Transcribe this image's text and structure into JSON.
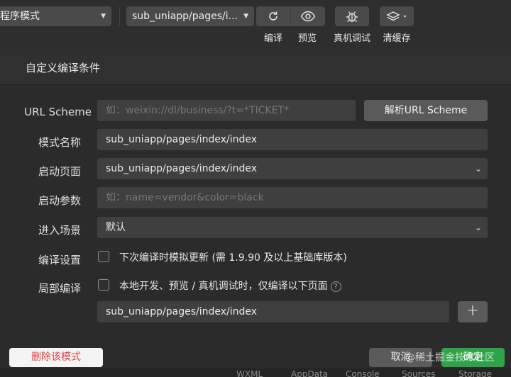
{
  "toolbar": {
    "mode_dropdown": "程序模式",
    "page_dropdown": "sub_uniapp/pages/i...",
    "buttons": {
      "compile": "编译",
      "preview": "预览",
      "remote_debug": "真机调试",
      "clear_cache": "清缓存"
    }
  },
  "dialog": {
    "title": "自定义编译条件",
    "url_scheme": {
      "label": "URL Scheme",
      "placeholder": "如：weixin://dl/business/?t=*TICKET*",
      "parse_button": "解析URL Scheme"
    },
    "mode_name": {
      "label": "模式名称",
      "value": "sub_uniapp/pages/index/index"
    },
    "start_page": {
      "label": "启动页面",
      "value": "sub_uniapp/pages/index/index"
    },
    "start_params": {
      "label": "启动参数",
      "placeholder": "如：name=vendor&color=black"
    },
    "scene": {
      "label": "进入场景",
      "value": "默认"
    },
    "compile_settings": {
      "label": "编译设置",
      "checkbox_text": "下次编译时模拟更新 (需 1.9.90 及以上基础库版本)",
      "checked": false
    },
    "partial_compile": {
      "label": "局部编译",
      "checkbox_text": "本地开发、预览 / 真机调试时，仅编译以下页面",
      "checked": false,
      "help_icon": "?",
      "page_value": "sub_uniapp/pages/index/index",
      "add_button": "+"
    },
    "footer": {
      "delete_button": "删除该模式",
      "cancel_button": "取消",
      "ok_button": "确定",
      "watermark": "@稀土掘金技术社区"
    }
  },
  "background_tabs": [
    "WXML",
    "AppData",
    "Console",
    "Sources",
    "Storage"
  ],
  "colors": {
    "background": "#2b2b2b",
    "field": "#3f3f3f",
    "confirm": "#2fa34a",
    "danger_text": "#e34242"
  }
}
